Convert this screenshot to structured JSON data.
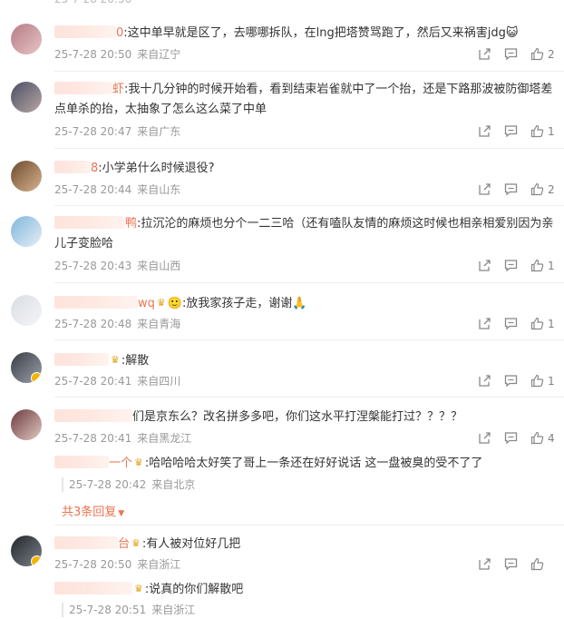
{
  "comments": [
    {
      "name_tail": "0",
      "text": ":这中单早就是区了，去哪哪拆队，在lng把塔赞骂跑了，然后又来祸害jdg",
      "emoji": "😺",
      "time": "25-7-28 20:50",
      "loc": "来自辽宁",
      "likes": "2"
    },
    {
      "name_tail": "虾",
      "text": ":我十几分钟的时候开始看，看到结束岩雀就中了一个抬，还是下路那波被防御塔差点单杀的抬，太抽象了怎么这么菜了中单",
      "time": "25-7-28 20:47",
      "loc": "来自广东",
      "likes": "1"
    },
    {
      "name_tail": "8",
      "text": ":小学弟什么时候退役?",
      "time": "25-7-28 20:44",
      "loc": "来自山东",
      "likes": "2"
    },
    {
      "name_tail": "鸭",
      "text": ":拉沉沦的麻烦也分个一二三哈（还有嗑队友情的麻烦这时候也相亲相爱别因为亲儿子变脸哈",
      "time": "25-7-28 20:43",
      "loc": "来自山西",
      "likes": "1"
    },
    {
      "name_tail": "wq",
      "text": ":放我家孩子走，谢谢",
      "emoji_pre": "🙂",
      "emoji": "🙏",
      "time": "25-7-28 20:48",
      "loc": "来自青海",
      "likes": "1"
    },
    {
      "name_tail": "",
      "text": ":解散",
      "time": "25-7-28 20:41",
      "loc": "来自四川",
      "likes": "1"
    },
    {
      "name_tail": "们是京东么？",
      "text": "改名拼多多吧，你们这水平打涅槃能打过？？？？",
      "time": "25-7-28 20:41",
      "loc": "来自黑龙江",
      "likes": "4",
      "reply": {
        "name_tail": "一个",
        "text": ":哈哈哈哈太好笑了哥上一条还在好好说话 这一盘被臭的受不了了",
        "time": "25-7-28 20:42",
        "loc": "来自北京"
      },
      "more": "共3条回复"
    },
    {
      "name_tail": "台",
      "text": ":有人被对位好几把",
      "time": "25-7-28 20:50",
      "loc": "来自浙江",
      "likes": "",
      "reply": {
        "name_tail": "",
        "text": ":说真的你们解散吧",
        "time": "25-7-28 20:51",
        "loc": "来自浙江"
      }
    }
  ],
  "icons": {
    "share": "share-icon",
    "comment": "comment-icon",
    "like": "like-icon"
  },
  "colors": {
    "username": "#eb7350",
    "meta": "#999999",
    "text": "#333333"
  }
}
